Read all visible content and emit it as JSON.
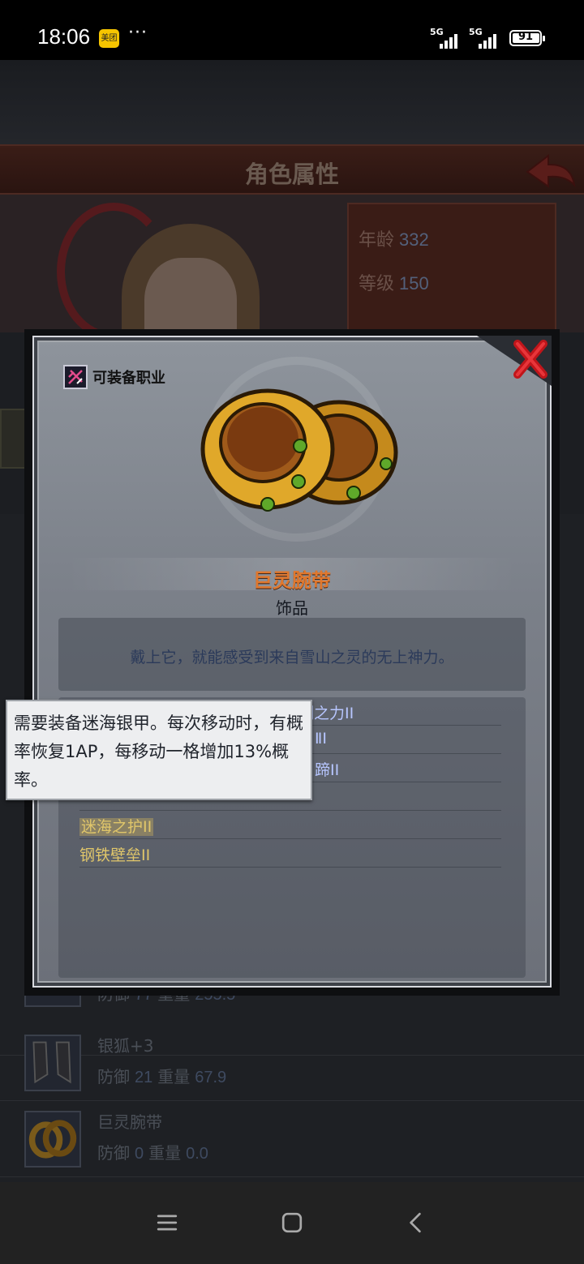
{
  "status_bar": {
    "time": "18:06",
    "app_badge": "美团",
    "dots": "···",
    "signal1": "5G",
    "signal2": "5G",
    "battery": "91"
  },
  "background": {
    "screen_title": "角色属性",
    "stats": [
      {
        "label": "年龄",
        "value": "332"
      },
      {
        "label": "等级",
        "value": "150"
      }
    ],
    "items": [
      {
        "name": "",
        "defense_label": "防御",
        "defense": "77",
        "weight_label": "重量",
        "weight": "255.5"
      },
      {
        "name": "银狐+3",
        "defense_label": "防御",
        "defense": "21",
        "weight_label": "重量",
        "weight": "67.9"
      },
      {
        "name": "巨灵腕带",
        "defense_label": "防御",
        "defense": "0",
        "weight_label": "重量",
        "weight": "0.0"
      }
    ]
  },
  "modal": {
    "class_label": "可装备职业",
    "item_name": "巨灵腕带",
    "item_type": "饰品",
    "description": "戴上它，就能感受到来自雪山之灵的无上神力。",
    "set_effects": [
      {
        "text": "制之力II",
        "style": "blue"
      },
      {
        "text": "ⅡI",
        "style": "blue"
      },
      {
        "text": "蹄II",
        "style": "blue"
      },
      {
        "text": "",
        "style": "blue"
      },
      {
        "text": "迷海之护II",
        "style": "gold"
      },
      {
        "text": "钢铁壁垒II",
        "style": "gold"
      }
    ]
  },
  "tooltip": {
    "text": "需要装备迷海银甲。每次移动时，有概率恢复1AP，每移动一格增加13%概率。"
  },
  "colors": {
    "item_title": "#e0782e",
    "close_x": "#c0151a",
    "modal_panel": "#7b8089"
  }
}
